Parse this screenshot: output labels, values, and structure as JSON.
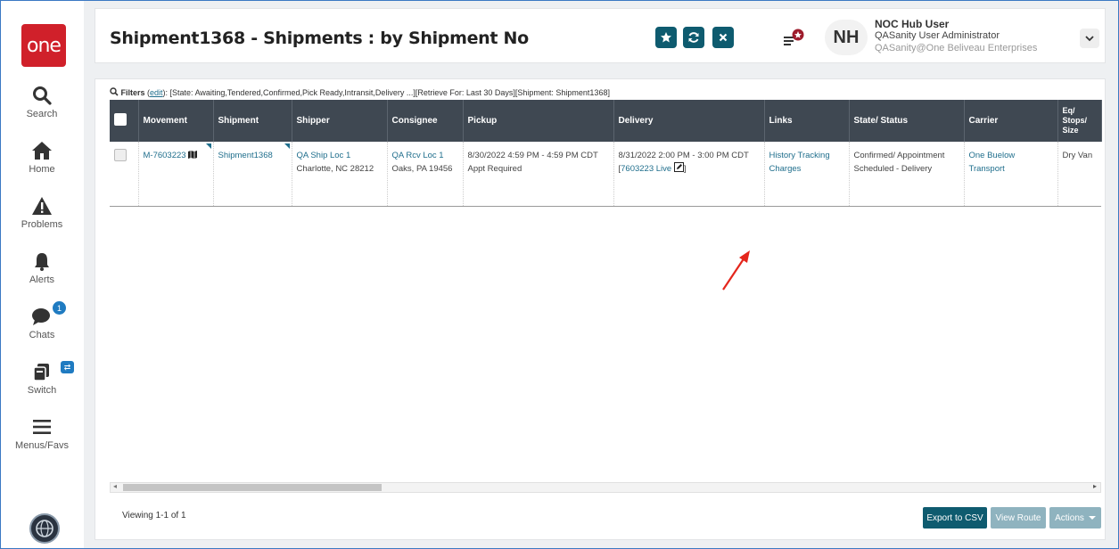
{
  "app": {
    "logo_text": "one",
    "accent": "#0e5b6f",
    "brand": "#d0202a"
  },
  "sidebar": {
    "items": [
      {
        "label": "Search",
        "icon": "search-icon"
      },
      {
        "label": "Home",
        "icon": "home-icon"
      },
      {
        "label": "Problems",
        "icon": "warning-icon"
      },
      {
        "label": "Alerts",
        "icon": "bell-icon"
      },
      {
        "label": "Chats",
        "icon": "chat-icon",
        "badge": "1"
      },
      {
        "label": "Switch",
        "icon": "switch-icon"
      },
      {
        "label": "Menus/Favs",
        "icon": "hamburger-icon"
      }
    ]
  },
  "header": {
    "title": "Shipment1368 - Shipments : by Shipment No",
    "user_initials": "NH",
    "user_name": "NOC Hub User",
    "user_role": "QASanity User Administrator",
    "user_org": "QASanity@One Beliveau Enterprises"
  },
  "filters": {
    "label": "Filters",
    "edit": "edit",
    "text": "[State: Awaiting,Tendered,Confirmed,Pick Ready,Intransit,Delivery ...][Retrieve For: Last 30 Days][Shipment: Shipment1368]"
  },
  "table": {
    "columns": [
      "Movement",
      "Shipment",
      "Shipper",
      "Consignee",
      "Pickup",
      "Delivery",
      "Links",
      "State/ Status",
      "Carrier",
      "Eq/ Stops/ Size"
    ],
    "row": {
      "movement": "M-7603223",
      "shipment": "Shipment1368",
      "shipper_name": "QA Ship Loc 1",
      "shipper_city": "Charlotte, NC 28212",
      "consignee_name": "QA Rcv Loc 1",
      "consignee_city": "Oaks, PA 19456",
      "pickup_time": "8/30/2022 4:59 PM - 4:59 PM CDT",
      "pickup_note": "Appt Required",
      "delivery_time": "8/31/2022 2:00 PM - 3:00 PM CDT",
      "delivery_ref": "7603223",
      "delivery_live": "Live",
      "links": "History Tracking Charges",
      "state": "Confirmed/ Appointment Scheduled - Delivery",
      "carrier": "One Buelow Transport",
      "equipment": "Dry Van"
    }
  },
  "footer": {
    "viewing": "Viewing 1-1 of 1",
    "export": "Export to CSV",
    "view_route": "View Route",
    "actions": "Actions"
  }
}
